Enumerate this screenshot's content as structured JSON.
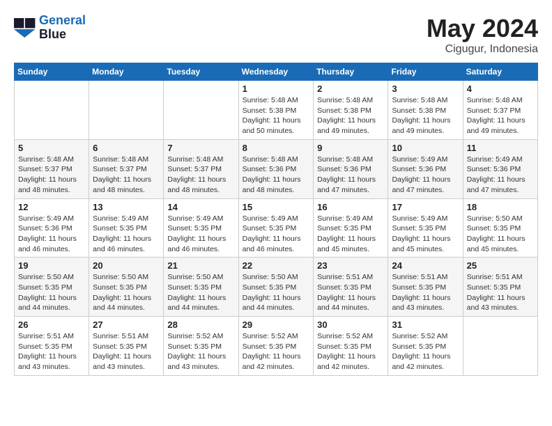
{
  "header": {
    "logo_line1": "General",
    "logo_line2": "Blue",
    "month_year": "May 2024",
    "location": "Cigugur, Indonesia"
  },
  "weekdays": [
    "Sunday",
    "Monday",
    "Tuesday",
    "Wednesday",
    "Thursday",
    "Friday",
    "Saturday"
  ],
  "weeks": [
    [
      {
        "day": "",
        "info": ""
      },
      {
        "day": "",
        "info": ""
      },
      {
        "day": "",
        "info": ""
      },
      {
        "day": "1",
        "info": "Sunrise: 5:48 AM\nSunset: 5:38 PM\nDaylight: 11 hours\nand 50 minutes."
      },
      {
        "day": "2",
        "info": "Sunrise: 5:48 AM\nSunset: 5:38 PM\nDaylight: 11 hours\nand 49 minutes."
      },
      {
        "day": "3",
        "info": "Sunrise: 5:48 AM\nSunset: 5:38 PM\nDaylight: 11 hours\nand 49 minutes."
      },
      {
        "day": "4",
        "info": "Sunrise: 5:48 AM\nSunset: 5:37 PM\nDaylight: 11 hours\nand 49 minutes."
      }
    ],
    [
      {
        "day": "5",
        "info": "Sunrise: 5:48 AM\nSunset: 5:37 PM\nDaylight: 11 hours\nand 48 minutes."
      },
      {
        "day": "6",
        "info": "Sunrise: 5:48 AM\nSunset: 5:37 PM\nDaylight: 11 hours\nand 48 minutes."
      },
      {
        "day": "7",
        "info": "Sunrise: 5:48 AM\nSunset: 5:37 PM\nDaylight: 11 hours\nand 48 minutes."
      },
      {
        "day": "8",
        "info": "Sunrise: 5:48 AM\nSunset: 5:36 PM\nDaylight: 11 hours\nand 48 minutes."
      },
      {
        "day": "9",
        "info": "Sunrise: 5:48 AM\nSunset: 5:36 PM\nDaylight: 11 hours\nand 47 minutes."
      },
      {
        "day": "10",
        "info": "Sunrise: 5:49 AM\nSunset: 5:36 PM\nDaylight: 11 hours\nand 47 minutes."
      },
      {
        "day": "11",
        "info": "Sunrise: 5:49 AM\nSunset: 5:36 PM\nDaylight: 11 hours\nand 47 minutes."
      }
    ],
    [
      {
        "day": "12",
        "info": "Sunrise: 5:49 AM\nSunset: 5:36 PM\nDaylight: 11 hours\nand 46 minutes."
      },
      {
        "day": "13",
        "info": "Sunrise: 5:49 AM\nSunset: 5:35 PM\nDaylight: 11 hours\nand 46 minutes."
      },
      {
        "day": "14",
        "info": "Sunrise: 5:49 AM\nSunset: 5:35 PM\nDaylight: 11 hours\nand 46 minutes."
      },
      {
        "day": "15",
        "info": "Sunrise: 5:49 AM\nSunset: 5:35 PM\nDaylight: 11 hours\nand 46 minutes."
      },
      {
        "day": "16",
        "info": "Sunrise: 5:49 AM\nSunset: 5:35 PM\nDaylight: 11 hours\nand 45 minutes."
      },
      {
        "day": "17",
        "info": "Sunrise: 5:49 AM\nSunset: 5:35 PM\nDaylight: 11 hours\nand 45 minutes."
      },
      {
        "day": "18",
        "info": "Sunrise: 5:50 AM\nSunset: 5:35 PM\nDaylight: 11 hours\nand 45 minutes."
      }
    ],
    [
      {
        "day": "19",
        "info": "Sunrise: 5:50 AM\nSunset: 5:35 PM\nDaylight: 11 hours\nand 44 minutes."
      },
      {
        "day": "20",
        "info": "Sunrise: 5:50 AM\nSunset: 5:35 PM\nDaylight: 11 hours\nand 44 minutes."
      },
      {
        "day": "21",
        "info": "Sunrise: 5:50 AM\nSunset: 5:35 PM\nDaylight: 11 hours\nand 44 minutes."
      },
      {
        "day": "22",
        "info": "Sunrise: 5:50 AM\nSunset: 5:35 PM\nDaylight: 11 hours\nand 44 minutes."
      },
      {
        "day": "23",
        "info": "Sunrise: 5:51 AM\nSunset: 5:35 PM\nDaylight: 11 hours\nand 44 minutes."
      },
      {
        "day": "24",
        "info": "Sunrise: 5:51 AM\nSunset: 5:35 PM\nDaylight: 11 hours\nand 43 minutes."
      },
      {
        "day": "25",
        "info": "Sunrise: 5:51 AM\nSunset: 5:35 PM\nDaylight: 11 hours\nand 43 minutes."
      }
    ],
    [
      {
        "day": "26",
        "info": "Sunrise: 5:51 AM\nSunset: 5:35 PM\nDaylight: 11 hours\nand 43 minutes."
      },
      {
        "day": "27",
        "info": "Sunrise: 5:51 AM\nSunset: 5:35 PM\nDaylight: 11 hours\nand 43 minutes."
      },
      {
        "day": "28",
        "info": "Sunrise: 5:52 AM\nSunset: 5:35 PM\nDaylight: 11 hours\nand 43 minutes."
      },
      {
        "day": "29",
        "info": "Sunrise: 5:52 AM\nSunset: 5:35 PM\nDaylight: 11 hours\nand 42 minutes."
      },
      {
        "day": "30",
        "info": "Sunrise: 5:52 AM\nSunset: 5:35 PM\nDaylight: 11 hours\nand 42 minutes."
      },
      {
        "day": "31",
        "info": "Sunrise: 5:52 AM\nSunset: 5:35 PM\nDaylight: 11 hours\nand 42 minutes."
      },
      {
        "day": "",
        "info": ""
      }
    ]
  ]
}
